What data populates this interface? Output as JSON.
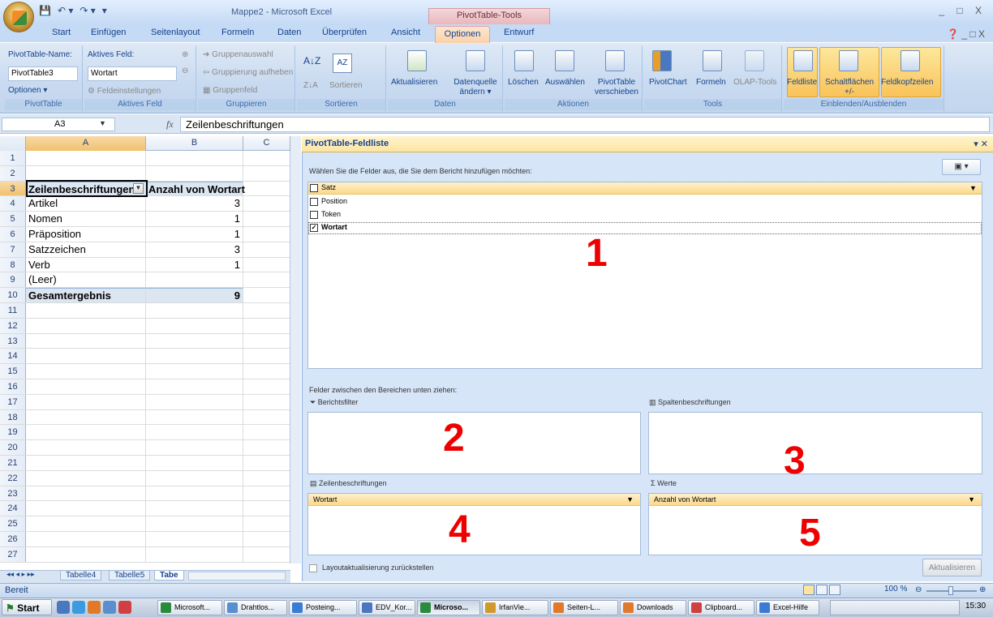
{
  "window": {
    "title": "Mappe2 - Microsoft Excel",
    "context_tab_group": "PivotTable-Tools",
    "controls": "_ □ X",
    "help_controls": "❓ _ □ X"
  },
  "tabs": [
    "Start",
    "Einfügen",
    "Seitenlayout",
    "Formeln",
    "Daten",
    "Überprüfen",
    "Ansicht",
    "Optionen",
    "Entwurf"
  ],
  "active_tab": "Optionen",
  "ribbon": {
    "pivottable": {
      "name_label": "PivotTable-Name:",
      "name_value": "PivotTable3",
      "options_label": "Optionen ▾",
      "group_label": "PivotTable"
    },
    "active_field": {
      "label": "Aktives Feld:",
      "value": "Wortart",
      "settings_label": "Feldeinstellungen",
      "group_label": "Aktives Feld"
    },
    "group": {
      "selection": "Gruppenauswahl",
      "ungroup": "Gruppierung aufheben",
      "field": "Gruppenfeld",
      "group_label": "Gruppieren"
    },
    "sort": {
      "sort_label": "Sortieren",
      "group_label": "Sortieren"
    },
    "data": {
      "refresh": "Aktualisieren",
      "change_source": "Datenquelle ändern ▾",
      "group_label": "Daten"
    },
    "actions": {
      "clear": "Löschen",
      "select": "Auswählen",
      "move": "PivotTable verschieben",
      "group_label": "Aktionen"
    },
    "tools": {
      "pivotchart": "PivotChart",
      "formulas": "Formeln",
      "olap": "OLAP-Tools",
      "group_label": "Tools"
    },
    "show_hide": {
      "field_list": "Feldliste",
      "buttons": "Schaltflächen +/-",
      "headers": "Feldkopfzeilen",
      "group_label": "Einblenden/Ausblenden"
    }
  },
  "formula_bar": {
    "name_box": "A3",
    "formula": "Zeilenbeschriftungen"
  },
  "sheet": {
    "columns": [
      "A",
      "B",
      "C"
    ],
    "rows": [
      {
        "n": "1",
        "a": "",
        "b": ""
      },
      {
        "n": "2",
        "a": "",
        "b": ""
      },
      {
        "n": "3",
        "a": "Zeilenbeschriftungen",
        "b": "Anzahl von Wortart"
      },
      {
        "n": "4",
        "a": "Artikel",
        "b": "3"
      },
      {
        "n": "5",
        "a": "Nomen",
        "b": "1"
      },
      {
        "n": "6",
        "a": "Präposition",
        "b": "1"
      },
      {
        "n": "7",
        "a": "Satzzeichen",
        "b": "3"
      },
      {
        "n": "8",
        "a": "Verb",
        "b": "1"
      },
      {
        "n": "9",
        "a": "(Leer)",
        "b": ""
      },
      {
        "n": "10",
        "a": "Gesamtergebnis",
        "b": "9"
      },
      {
        "n": "11",
        "a": "",
        "b": ""
      },
      {
        "n": "12",
        "a": "",
        "b": ""
      },
      {
        "n": "13",
        "a": "",
        "b": ""
      },
      {
        "n": "14",
        "a": "",
        "b": ""
      },
      {
        "n": "15",
        "a": "",
        "b": ""
      },
      {
        "n": "16",
        "a": "",
        "b": ""
      },
      {
        "n": "17",
        "a": "",
        "b": ""
      },
      {
        "n": "18",
        "a": "",
        "b": ""
      },
      {
        "n": "19",
        "a": "",
        "b": ""
      },
      {
        "n": "20",
        "a": "",
        "b": ""
      },
      {
        "n": "21",
        "a": "",
        "b": ""
      },
      {
        "n": "22",
        "a": "",
        "b": ""
      },
      {
        "n": "23",
        "a": "",
        "b": ""
      },
      {
        "n": "24",
        "a": "",
        "b": ""
      },
      {
        "n": "25",
        "a": "",
        "b": ""
      },
      {
        "n": "26",
        "a": "",
        "b": ""
      },
      {
        "n": "27",
        "a": "",
        "b": ""
      }
    ],
    "sheet_tabs": [
      "Tabelle4",
      "Tabelle5",
      "Tabe"
    ]
  },
  "field_list": {
    "title": "PivotTable-Feldliste",
    "instruction": "Wählen Sie die Felder aus, die Sie dem Bericht hinzufügen möchten:",
    "fields": [
      {
        "name": "Satz",
        "checked": false
      },
      {
        "name": "Position",
        "checked": false
      },
      {
        "name": "Token",
        "checked": false
      },
      {
        "name": "Wortart",
        "checked": true
      }
    ],
    "drag_instruction": "Felder zwischen den Bereichen unten ziehen:",
    "areas": {
      "filter": "Berichtsfilter",
      "columns": "Spaltenbeschriftungen",
      "rows": "Zeilenbeschriftungen",
      "values": "Werte",
      "rows_field": "Wortart",
      "values_field": "Anzahl von Wortart"
    },
    "defer_label": "Layoutaktualisierung zurückstellen",
    "update_button": "Aktualisieren",
    "annotations": [
      "1",
      "2",
      "3",
      "4",
      "5"
    ]
  },
  "status": {
    "text": "Bereit",
    "zoom": "100 %"
  },
  "taskbar": {
    "start": "Start",
    "items": [
      "Microsoft...",
      "Drahtlos...",
      "Posteing...",
      "EDV_Kor...",
      "Microso...",
      "IrfanVie...",
      "Seiten-L...",
      "Downloads",
      "Clipboard...",
      "Excel-Hilfe"
    ],
    "clock": "15:30"
  },
  "colors": {
    "accent": "#15428b",
    "highlight": "#fad2a9",
    "annotation": "#e00000"
  }
}
